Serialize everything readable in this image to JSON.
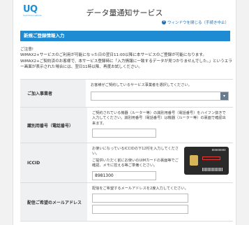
{
  "header": {
    "logo_mark": "UQ",
    "logo_sub": "Communications",
    "title": "データ量通知サービス",
    "close_link": "ウィンドウを閉じる（手続き中止）"
  },
  "section": {
    "title": "新規ご登録情報入力"
  },
  "notice": {
    "line1": "ご注意!",
    "line2": "WiMAX2+サービスのご利用が可能になった日の翌日11:00以降に本サービスのご登録が可能になります。",
    "line3": "WiMAX2+ご契約済のお客様で、本サービス登録時に「入力情報に一致するデータが見つかりませんでした。」というエラー画面が表示された場合には、翌日11時以降、再度お試しください。"
  },
  "form": {
    "provider": {
      "label": "ご加入事業者",
      "help": "お客様がご契約しているサービス事業者を選択してください。",
      "value": ""
    },
    "phone": {
      "label": "識別用番号（電話番号）",
      "help": "ご契約されている機器（ルーター等）の識別用番号（電話番号）をハイフン抜きで入力してください。識別用番号（電話番号）は機器（ルーター等）の裏面で確認出来ます。",
      "value": ""
    },
    "iccid": {
      "label": "ICCID",
      "help1": "お使いになっているICCIDの下12桁を入力してください。",
      "help2": "ご提供いただく前にお使いのUIMカードの裏面等でご確認、メモに控える等ご準備ください。",
      "value": "8981300"
    },
    "email": {
      "label": "配信ご希望のメールアドレス",
      "help": "配信をご希望するメールアドレスを2度入力してください。",
      "value1": "",
      "value2": ""
    }
  },
  "colors": {
    "accent": "#1e8bd3",
    "label_bg": "#eef0f2"
  }
}
